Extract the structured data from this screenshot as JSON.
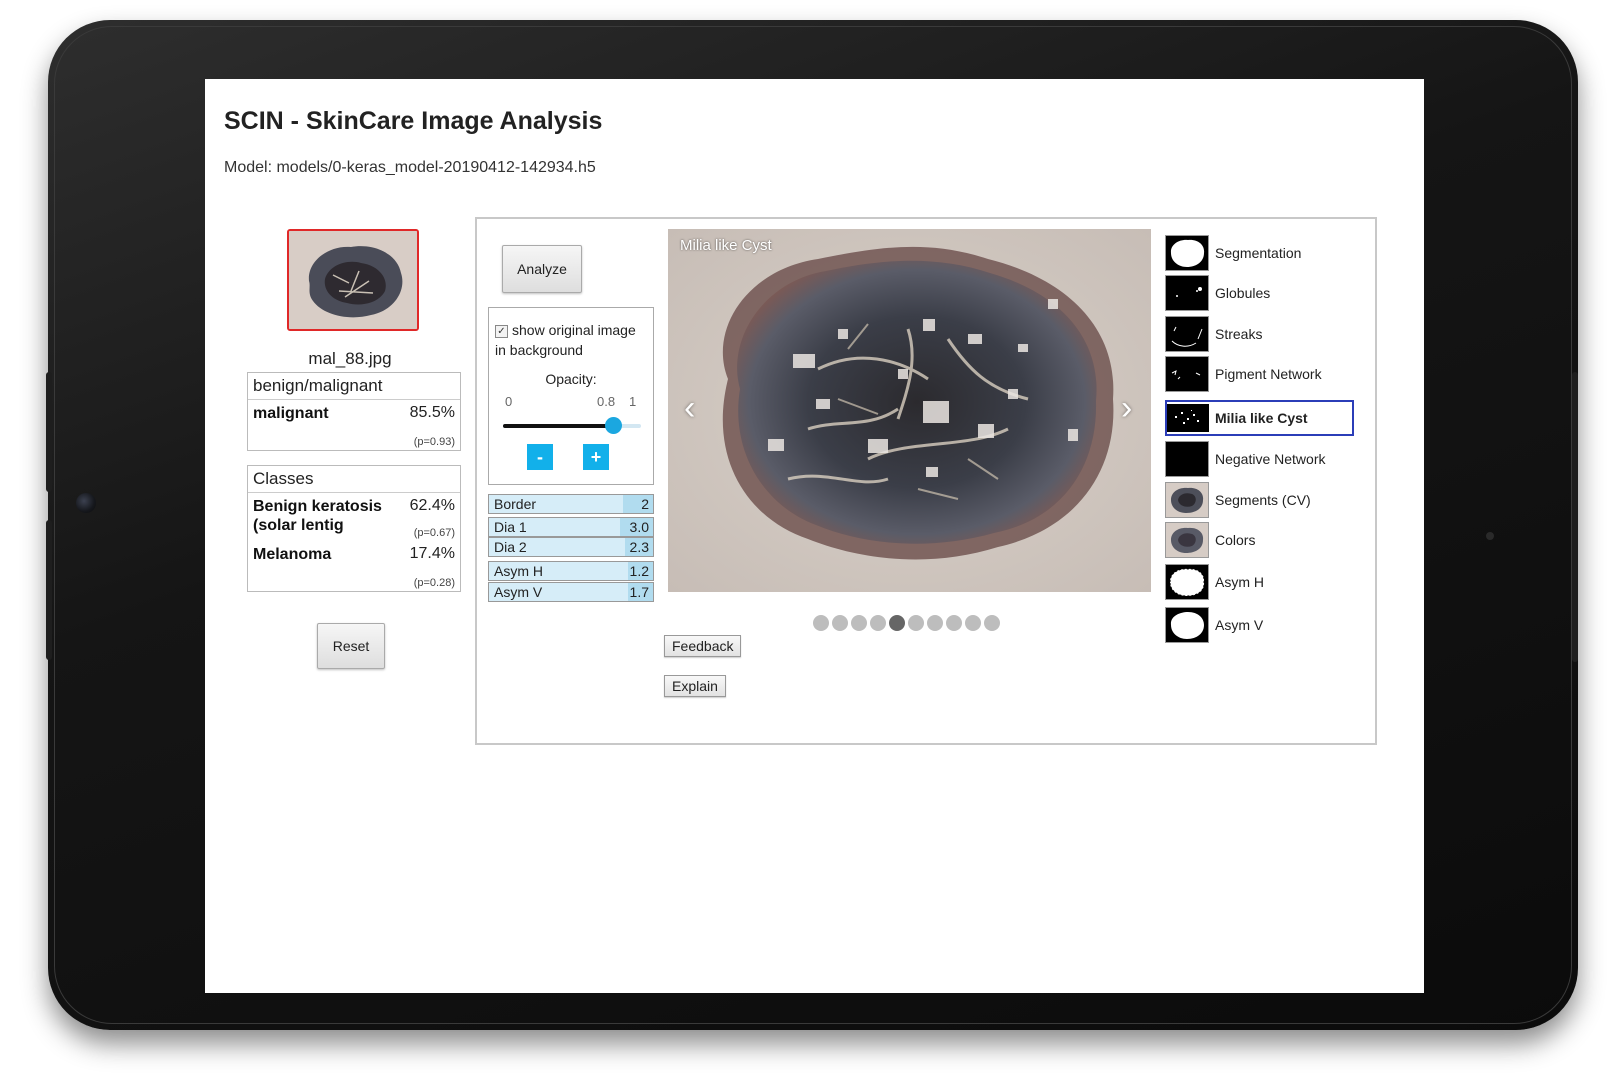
{
  "app": {
    "title": "SCIN - SkinCare Image Analysis",
    "model": "Model: models/0-keras_model-20190412-142934.h5"
  },
  "sidebar": {
    "thumbnail_name": "mal_88.jpg",
    "benign_malignant": {
      "header": "benign/malignant",
      "rows": [
        {
          "label": "malignant",
          "percent": "85.5%",
          "p": "(p=0.93)"
        }
      ]
    },
    "classes": {
      "header": "Classes",
      "rows": [
        {
          "label": "Benign keratosis (solar lentig",
          "percent": "62.4%",
          "p": "(p=0.67)"
        },
        {
          "label": "Melanoma",
          "percent": "17.4%",
          "p": "(p=0.28)"
        }
      ]
    },
    "reset_label": "Reset"
  },
  "controls": {
    "analyze_label": "Analyze",
    "show_original_label": "show original image in background",
    "show_original_checked": true,
    "opacity_label": "Opacity:",
    "opacity_min": "0",
    "opacity_value": "0.8",
    "opacity_max": "1",
    "opacity_fraction": 0.8,
    "minus_label": "-",
    "plus_label": "+"
  },
  "metrics": [
    {
      "label": "Border",
      "value": "2",
      "fraction": 0.18
    },
    {
      "label": "Dia 1",
      "value": "3.0",
      "fraction": 0.2
    },
    {
      "label": "Dia 2",
      "value": "2.3",
      "fraction": 0.17
    },
    {
      "label": "Asym H",
      "value": "1.2",
      "fraction": 0.15
    },
    {
      "label": "Asym V",
      "value": "1.7",
      "fraction": 0.15
    }
  ],
  "viewer": {
    "label": "Milia like Cyst",
    "prev_glyph": "‹",
    "next_glyph": "›",
    "dot_count": 10,
    "active_dot": 5
  },
  "actions": {
    "feedback_label": "Feedback",
    "explain_label": "Explain"
  },
  "layers": [
    {
      "label": "Segmentation",
      "icon": "segmentation-mask-icon"
    },
    {
      "label": "Globules",
      "icon": "globules-mask-icon"
    },
    {
      "label": "Streaks",
      "icon": "streaks-mask-icon"
    },
    {
      "label": "Pigment Network",
      "icon": "pigment-network-mask-icon"
    },
    {
      "label": "Milia like Cyst",
      "icon": "milia-mask-icon",
      "selected": true
    },
    {
      "label": "Negative Network",
      "icon": "negative-network-mask-icon"
    },
    {
      "label": "Segments (CV)",
      "icon": "segments-cv-icon"
    },
    {
      "label": "Colors",
      "icon": "colors-icon"
    },
    {
      "label": "Asym H",
      "icon": "asym-h-mask-icon"
    },
    {
      "label": "Asym V",
      "icon": "asym-v-mask-icon"
    }
  ],
  "colors": {
    "accent": "#12b0ea",
    "selection_border": "#2b3db8",
    "thumb_border": "#e02828"
  }
}
